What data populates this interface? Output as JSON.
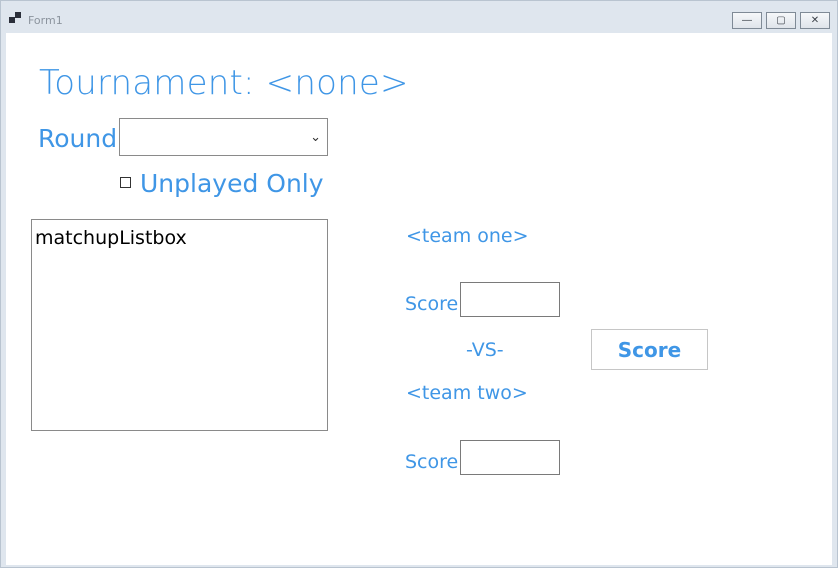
{
  "window": {
    "title": "Form1",
    "controls": {
      "minimize": "—",
      "maximize": "▢",
      "close": "✕"
    }
  },
  "form": {
    "tournament_label": "Tournament: <none>",
    "round_label": "Round",
    "round_selected": "",
    "unplayed_only_label": "Unplayed Only",
    "unplayed_only_checked": false,
    "matchup_listbox_item": "matchupListbox",
    "team_one_label": "<team one>",
    "team_two_label": "<team two>",
    "score_label": "Score",
    "team_one_score": "",
    "team_two_score": "",
    "vs_label": "-VS-",
    "score_button_label": "Score"
  },
  "colors": {
    "accent": "#3f96e6",
    "background": "#ffffff",
    "chrome": "#dfe6ee"
  }
}
